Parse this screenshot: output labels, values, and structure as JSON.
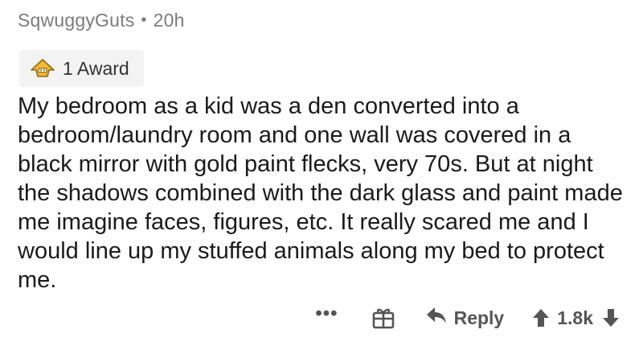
{
  "comment": {
    "author": "SqwuggyGuts",
    "separator": "•",
    "age": "20h",
    "award_label": "1 Award",
    "body": "My bedroom as a kid was a den converted into a bedroom/laundry room and one wall was covered in a black mirror with gold paint flecks, very 70s. But at night the shadows combined with the dark glass and paint made me imagine faces, figures, etc. It really scared me and I would line up my stuffed animals along my bed to protect me."
  },
  "actions": {
    "more_label": "•••",
    "reply_label": "Reply",
    "score": "1.8k"
  },
  "icons": {
    "award": "award-icon",
    "gift": "gift-icon",
    "reply": "reply-arrow-icon",
    "upvote": "upvote-arrow-icon",
    "downvote": "downvote-arrow-icon"
  },
  "colors": {
    "meta_text": "#7c7c7c",
    "body_text": "#1a1a1b",
    "action_text": "#555555",
    "award_bg": "#f3f3f3",
    "award_gold": "#f5b82e"
  }
}
